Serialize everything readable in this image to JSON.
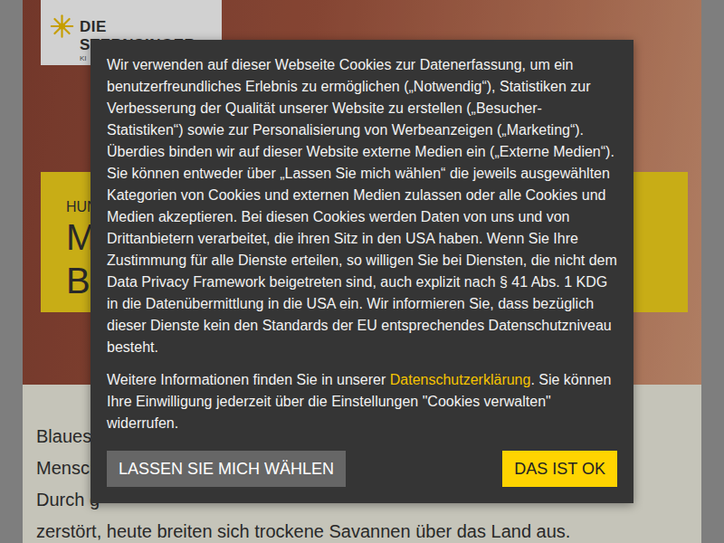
{
  "page": {
    "logo": {
      "title": "DIE STERNSINGER",
      "subtitle": "KI"
    },
    "banner": {
      "kicker": "HUN",
      "lines": [
        "M",
        "B"
      ]
    },
    "article_lines": [
      "Blaues",
      "Mensch",
      "Durch g",
      "zerstört, heute breiten sich trockene Savannen über das Land aus."
    ]
  },
  "cookie_dialog": {
    "text": "Wir verwenden auf dieser Webseite Cookies zur Datenerfassung, um ein benutzerfreundliches Erlebnis zu ermöglichen („Notwendig“), Statistiken zur Verbesserung der Qualität unserer Website zu erstellen („Besucher-Statistiken“) sowie zur Personalisierung von Werbeanzeigen („Marketing“). Überdies binden wir auf dieser Website externe Medien ein („Externe Medien“). Sie können entweder über „Lassen Sie mich wählen“ die jeweils ausgewählten Kategorien von Cookies und externen Medien zulassen oder alle Cookies und Medien akzeptieren. Bei diesen Cookies werden Daten von uns und von Drittanbietern verarbeitet, die ihren Sitz in den USA haben. Wenn Sie Ihre Zustimmung für alle Dienste erteilen, so willigen Sie bei Diensten, die nicht dem Data Privacy Framework beigetreten sind, auch explizit nach § 41 Abs. 1 KDG in die Datenübermittlung in die USA ein. Wir informieren Sie, dass bezüglich dieser Dienste kein den Standards der EU entsprechendes Datenschutzniveau besteht.",
    "info_before": "Weitere Informationen finden Sie in unserer ",
    "info_link": "Datenschutzerklärung",
    "info_after": ". Sie können Ihre Einwilligung jederzeit über die Einstellungen \"Cookies verwalten\" widerrufen.",
    "buttons": [
      {
        "label": "LASSEN SIE MICH WÄHLEN",
        "kind": "secondary"
      },
      {
        "label": "DAS IST OK",
        "kind": "primary"
      }
    ]
  }
}
